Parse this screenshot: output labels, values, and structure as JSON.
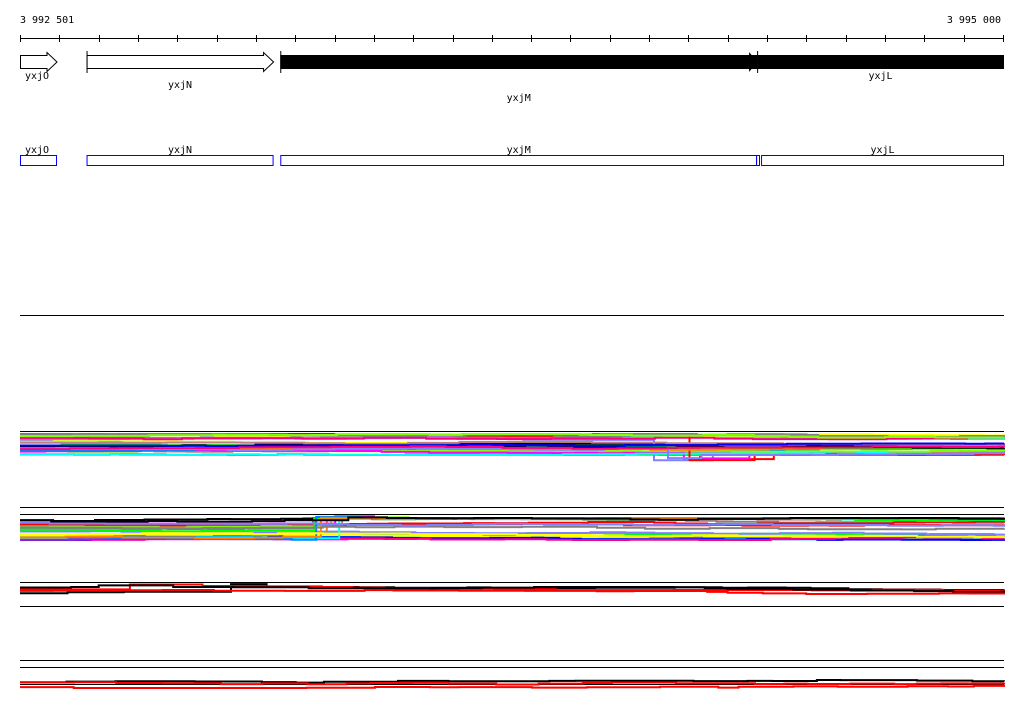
{
  "ruler": {
    "start_label": "3 992 501",
    "end_label": "3 995 000",
    "start": 3992501,
    "end": 3995000
  },
  "genes": [
    {
      "name": "yxjO",
      "start": 3992501,
      "end": 3992595,
      "strand": "+",
      "filled": false
    },
    {
      "name": "yxjN",
      "start": 3992670,
      "end": 3993145,
      "strand": "+",
      "filled": false
    },
    {
      "name": "yxjM",
      "start": 3993162,
      "end": 3994373,
      "strand": "+",
      "filled": true
    },
    {
      "name": "yxjL",
      "start": 3994373,
      "end": 3995000,
      "strand": "+",
      "filled": true
    }
  ],
  "annotation_boxes": [
    {
      "name": "yxjO",
      "start": 3992501,
      "end": 3992595
    },
    {
      "name": "yxjN",
      "start": 3992670,
      "end": 3993145
    },
    {
      "name": "yxjM",
      "start": 3993162,
      "end": 3994373
    },
    {
      "name": "yxjL",
      "start": 3994383,
      "end": 3995000
    }
  ],
  "colors": {
    "gene_box": "#0000ff",
    "palette": [
      "#ff00ff",
      "#00ffff",
      "#ff0000",
      "#00ff00",
      "#0080ff",
      "#ff8000",
      "#ffff00",
      "#808080",
      "#000000",
      "#8080ff",
      "#c08080",
      "#80ff00",
      "#0000ff",
      "#ff0080"
    ]
  },
  "tracks": [
    {
      "id": "multi-sample-1",
      "lanes": 28
    },
    {
      "id": "multi-sample-2",
      "lanes": 24
    },
    {
      "id": "strand-pair",
      "lanes": 4
    },
    {
      "id": "strand-pair-2",
      "lanes": 3
    }
  ]
}
